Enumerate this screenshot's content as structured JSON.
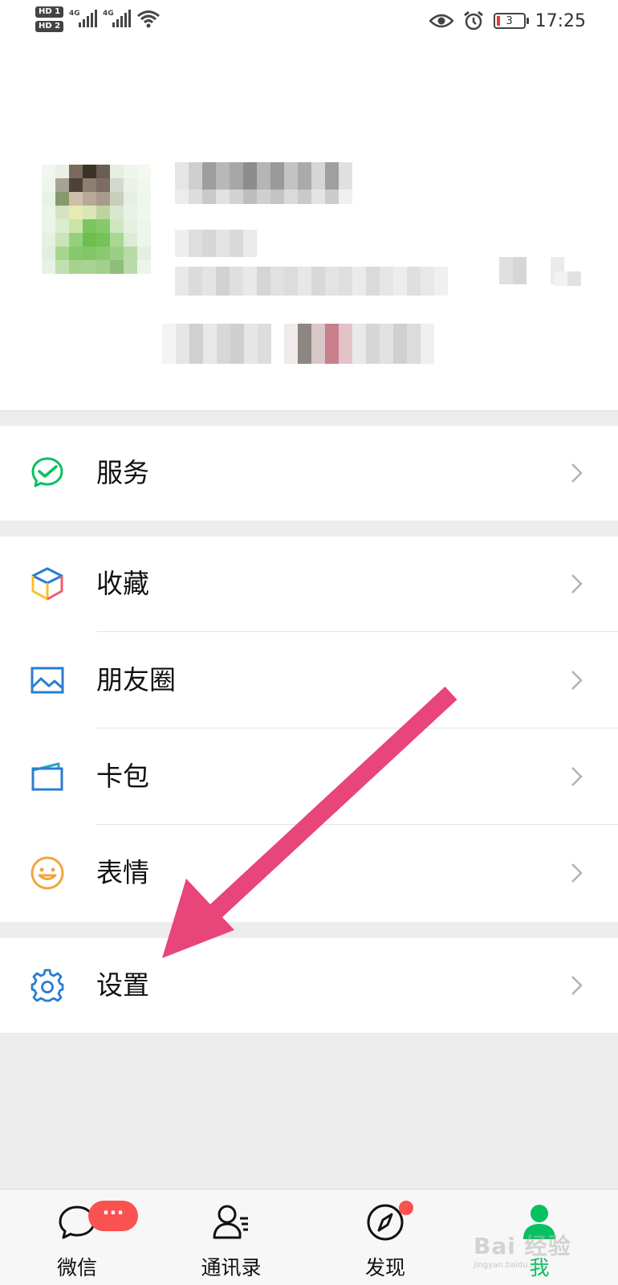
{
  "status_bar": {
    "sim1_badge": "HD 1",
    "sim2_badge": "HD 2",
    "signal1_label": "4G",
    "signal2_label": "4G",
    "battery_level": "3",
    "time": "17:25",
    "icons": [
      "eye-icon",
      "alarm-icon",
      "wifi-icon",
      "battery-icon"
    ]
  },
  "profile": {
    "note": ""
  },
  "menu": {
    "service_label": "服务",
    "favorites_label": "收藏",
    "moments_label": "朋友圈",
    "cards_label": "卡包",
    "stickers_label": "表情",
    "settings_label": "设置"
  },
  "tabbar": {
    "chats_label": "微信",
    "chats_badge": "···",
    "contacts_label": "通讯录",
    "discover_label": "发现",
    "me_label": "我"
  },
  "watermark": {
    "brand": "Bai 经验",
    "url": "jingyan.baidu.com"
  },
  "colors": {
    "accent_green": "#07c160",
    "badge_red": "#fa5151",
    "arrow_pink": "#e8457a",
    "icon_blue": "#2b7cd3",
    "sticker_orange": "#f2a53d"
  }
}
